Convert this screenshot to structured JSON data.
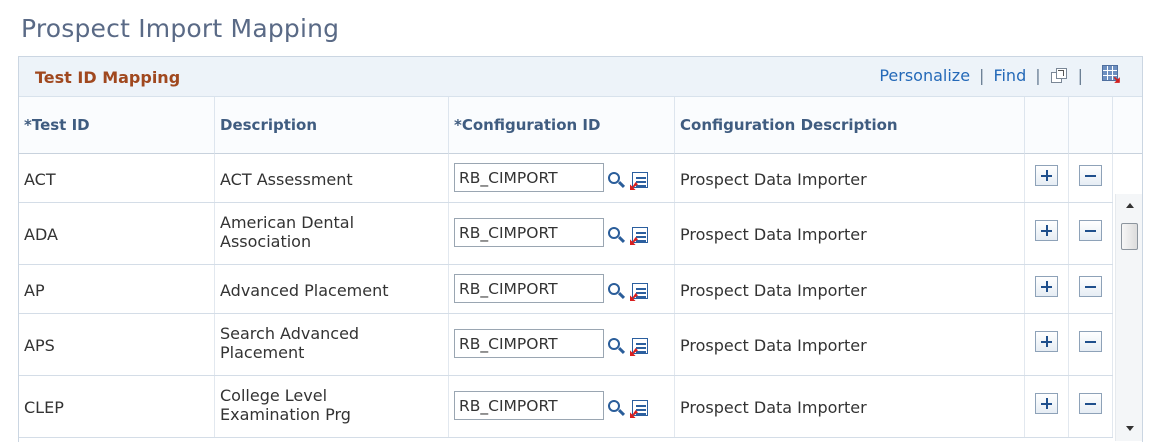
{
  "page": {
    "title": "Prospect Import Mapping"
  },
  "grid": {
    "title": "Test ID Mapping",
    "personalize_label": "Personalize",
    "find_label": "Find",
    "separator": "|",
    "icons": {
      "zoom": "view-all-icon",
      "download": "download-excel-icon"
    }
  },
  "columns": {
    "test_id": "*Test ID",
    "description": "Description",
    "config_id": "*Configuration ID",
    "config_desc": "Configuration Description"
  },
  "rows": [
    {
      "test_id": "ACT",
      "description": "ACT Assessment",
      "config_id": "RB_CIMPORT",
      "config_desc": "Prospect Data Importer"
    },
    {
      "test_id": "ADA",
      "description": "American Dental Association",
      "config_id": "RB_CIMPORT",
      "config_desc": "Prospect Data Importer"
    },
    {
      "test_id": "AP",
      "description": "Advanced Placement",
      "config_id": "RB_CIMPORT",
      "config_desc": "Prospect Data Importer"
    },
    {
      "test_id": "APS",
      "description": "Search Advanced Placement",
      "config_id": "RB_CIMPORT",
      "config_desc": "Prospect Data Importer"
    },
    {
      "test_id": "CLEP",
      "description": "College Level Examination Prg",
      "config_id": "RB_CIMPORT",
      "config_desc": "Prospect Data Importer"
    }
  ],
  "colors": {
    "title": "#5a6a86",
    "grid_title": "#a0481f",
    "link": "#2469b8",
    "header_text": "#3f5c80"
  }
}
